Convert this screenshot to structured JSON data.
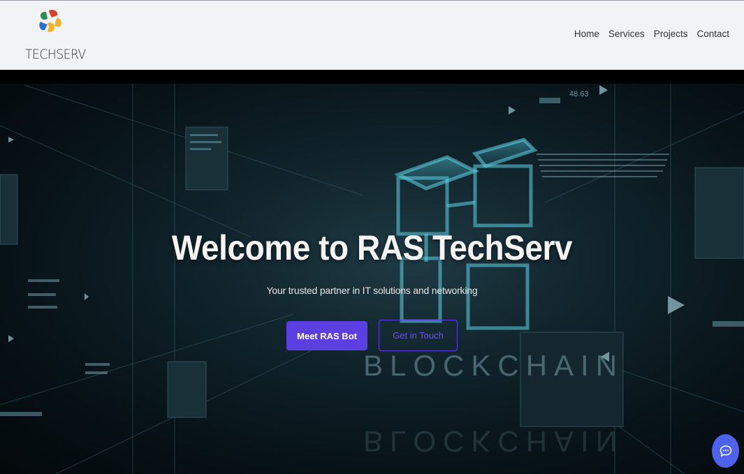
{
  "brand": {
    "logo_text": "TECHSERV"
  },
  "nav": {
    "items": [
      "Home",
      "Services",
      "Projects",
      "Contact"
    ]
  },
  "hero": {
    "title": "Welcome to RAS TechServ",
    "subtitle": "Your trusted partner in IT solutions and networking",
    "primary_button": "Meet RAS Bot",
    "secondary_button": "Get in Touch",
    "background_word": "BLOCKCHAIN",
    "background_number": "48.63"
  },
  "chat": {
    "icon": "chat-bubble-icon"
  },
  "colors": {
    "accent": "#5b3fe0",
    "chat": "#4d63f0",
    "header_bg": "#f2f3f4"
  }
}
